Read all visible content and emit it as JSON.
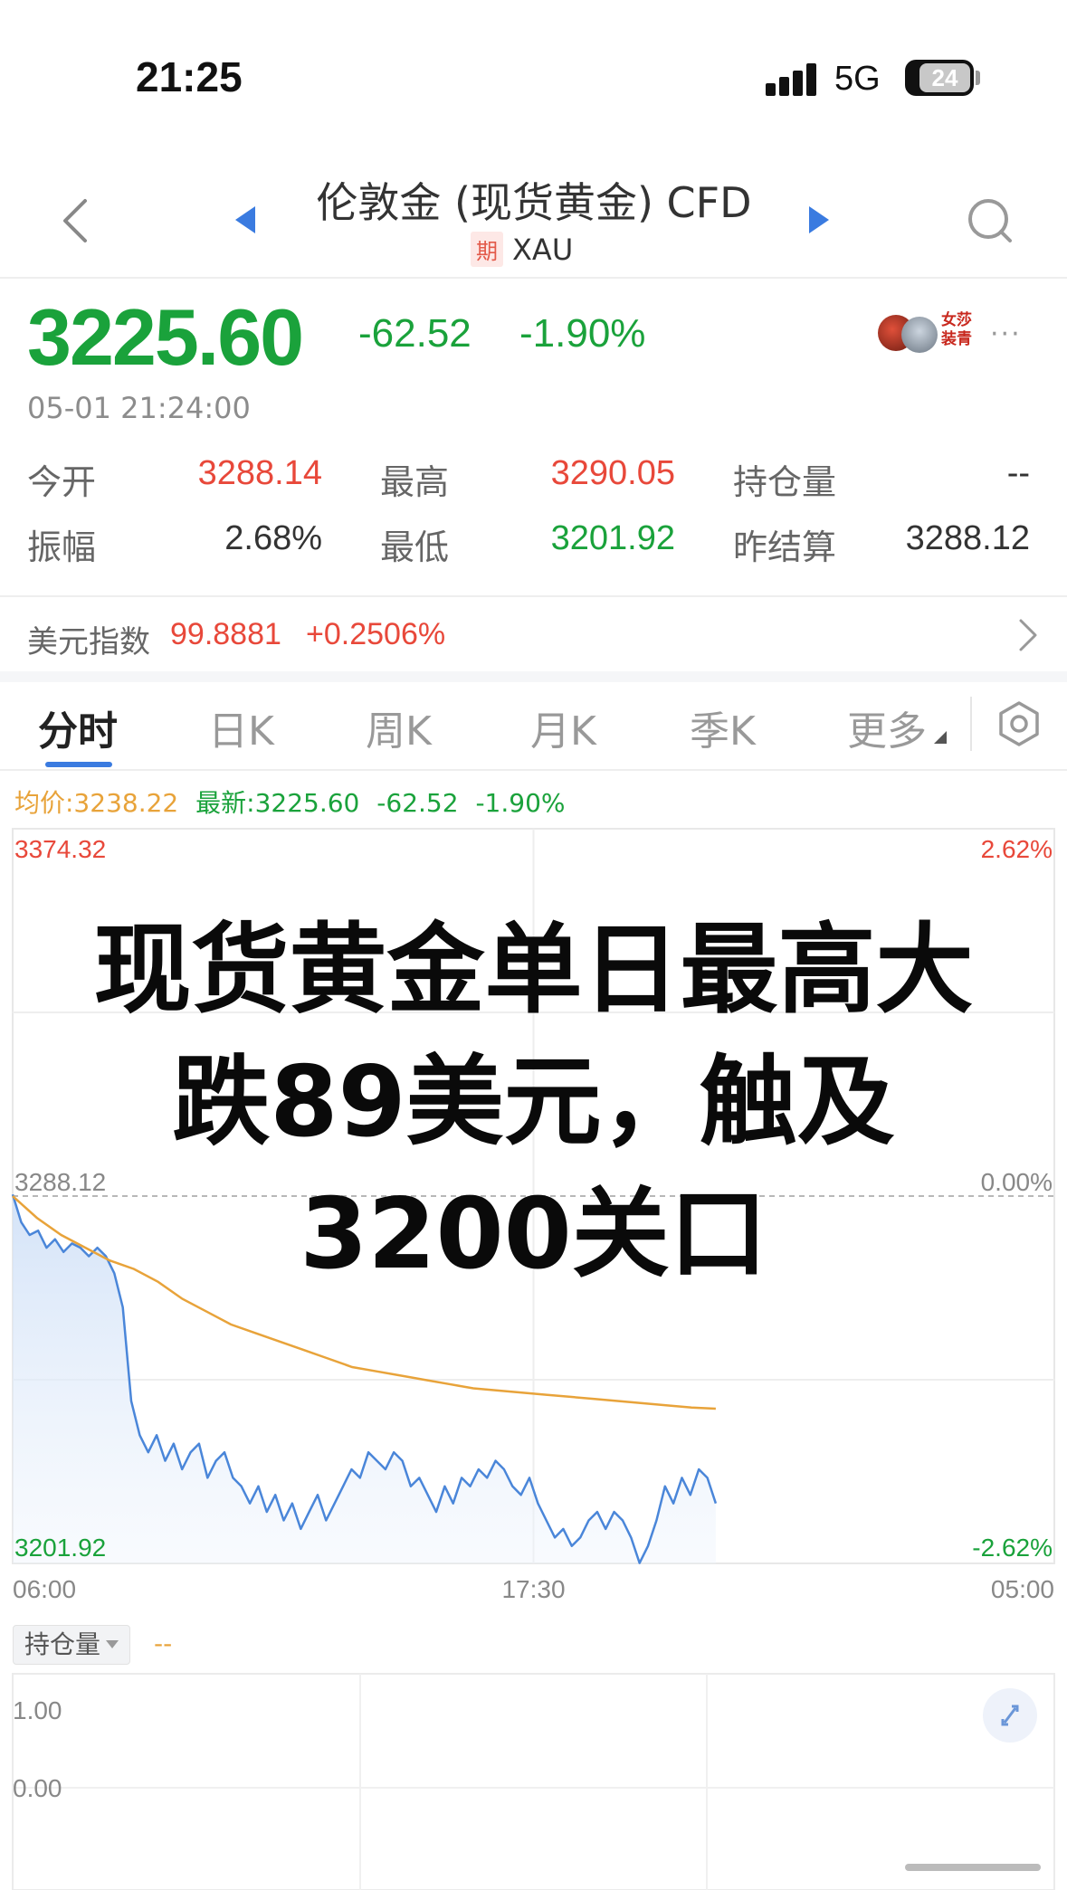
{
  "status_bar": {
    "time": "21:25",
    "network": "5G",
    "battery": "24"
  },
  "header": {
    "title": "伦敦金 (现货黄金) CFD",
    "badge": "期",
    "symbol": "XAU"
  },
  "quote": {
    "price": "3225.60",
    "change": "-62.52",
    "change_pct": "-1.90%",
    "timestamp": "05-01 21:24:00",
    "avatar_text": "女莎 装青"
  },
  "stats": [
    {
      "label": "今开",
      "value": "3288.14",
      "color": "red"
    },
    {
      "label": "最高",
      "value": "3290.05",
      "color": "red"
    },
    {
      "label": "持仓量",
      "value": "--",
      "color": "dark"
    },
    {
      "label": "振幅",
      "value": "2.68%",
      "color": "dark"
    },
    {
      "label": "最低",
      "value": "3201.92",
      "color": "green"
    },
    {
      "label": "昨结算",
      "value": "3288.12",
      "color": "dark"
    }
  ],
  "usd_index": {
    "label": "美元指数",
    "value": "99.8881",
    "change": "+0.2506%"
  },
  "tabs": [
    "分时",
    "日K",
    "周K",
    "月K",
    "季K",
    "更多"
  ],
  "chart_info": {
    "avg": "均价:3238.22",
    "latest": "最新:3225.60",
    "change": "-62.52",
    "change_pct": "-1.90%"
  },
  "overlay": {
    "line1": "现货黄金单日最高大",
    "line2": "跌89美元，触及",
    "line3": "3200关口"
  },
  "chart_data": {
    "type": "line",
    "x_ticks": [
      "06:00",
      "17:30",
      "05:00"
    ],
    "y_left_ticks": [
      "3374.32",
      "3288.12",
      "3201.92"
    ],
    "y_right_ticks": [
      "2.62%",
      "0.00%",
      "-2.62%"
    ],
    "ylim": [
      3201.92,
      3374.32
    ],
    "reference": 3288.12,
    "series": [
      {
        "color": "#4a86d9",
        "values": [
          3288.5,
          3282,
          3279,
          3280,
          3276,
          3278,
          3275,
          3277,
          3276,
          3274,
          3276,
          3274,
          3270,
          3262,
          3240,
          3232,
          3228,
          3232,
          3226,
          3230,
          3224,
          3228,
          3230,
          3222,
          3226,
          3228,
          3222,
          3220,
          3216,
          3220,
          3214,
          3218,
          3212,
          3216,
          3210,
          3214,
          3218,
          3212,
          3216,
          3220,
          3224,
          3222,
          3228,
          3226,
          3224,
          3228,
          3226,
          3220,
          3222,
          3218,
          3214,
          3220,
          3216,
          3222,
          3220,
          3224,
          3222,
          3226,
          3224,
          3220,
          3218,
          3222,
          3216,
          3212,
          3208,
          3210,
          3206,
          3208,
          3212,
          3214,
          3210,
          3214,
          3212,
          3208,
          3202,
          3206,
          3212,
          3220,
          3216,
          3222,
          3218,
          3224,
          3222,
          3216
        ]
      },
      {
        "color": "#e8a33a",
        "values": [
          3288.1,
          3283,
          3279,
          3276,
          3273,
          3271,
          3268,
          3264,
          3261,
          3258,
          3256,
          3254,
          3252,
          3250,
          3248,
          3247,
          3246,
          3245,
          3244,
          3243,
          3242.5,
          3242,
          3241.5,
          3241,
          3240.5,
          3240,
          3239.5,
          3239,
          3238.5,
          3238.22
        ]
      }
    ],
    "volume_panel": {
      "label": "持仓量",
      "value": "--",
      "y_ticks": [
        "1.00",
        "0.00"
      ]
    }
  }
}
